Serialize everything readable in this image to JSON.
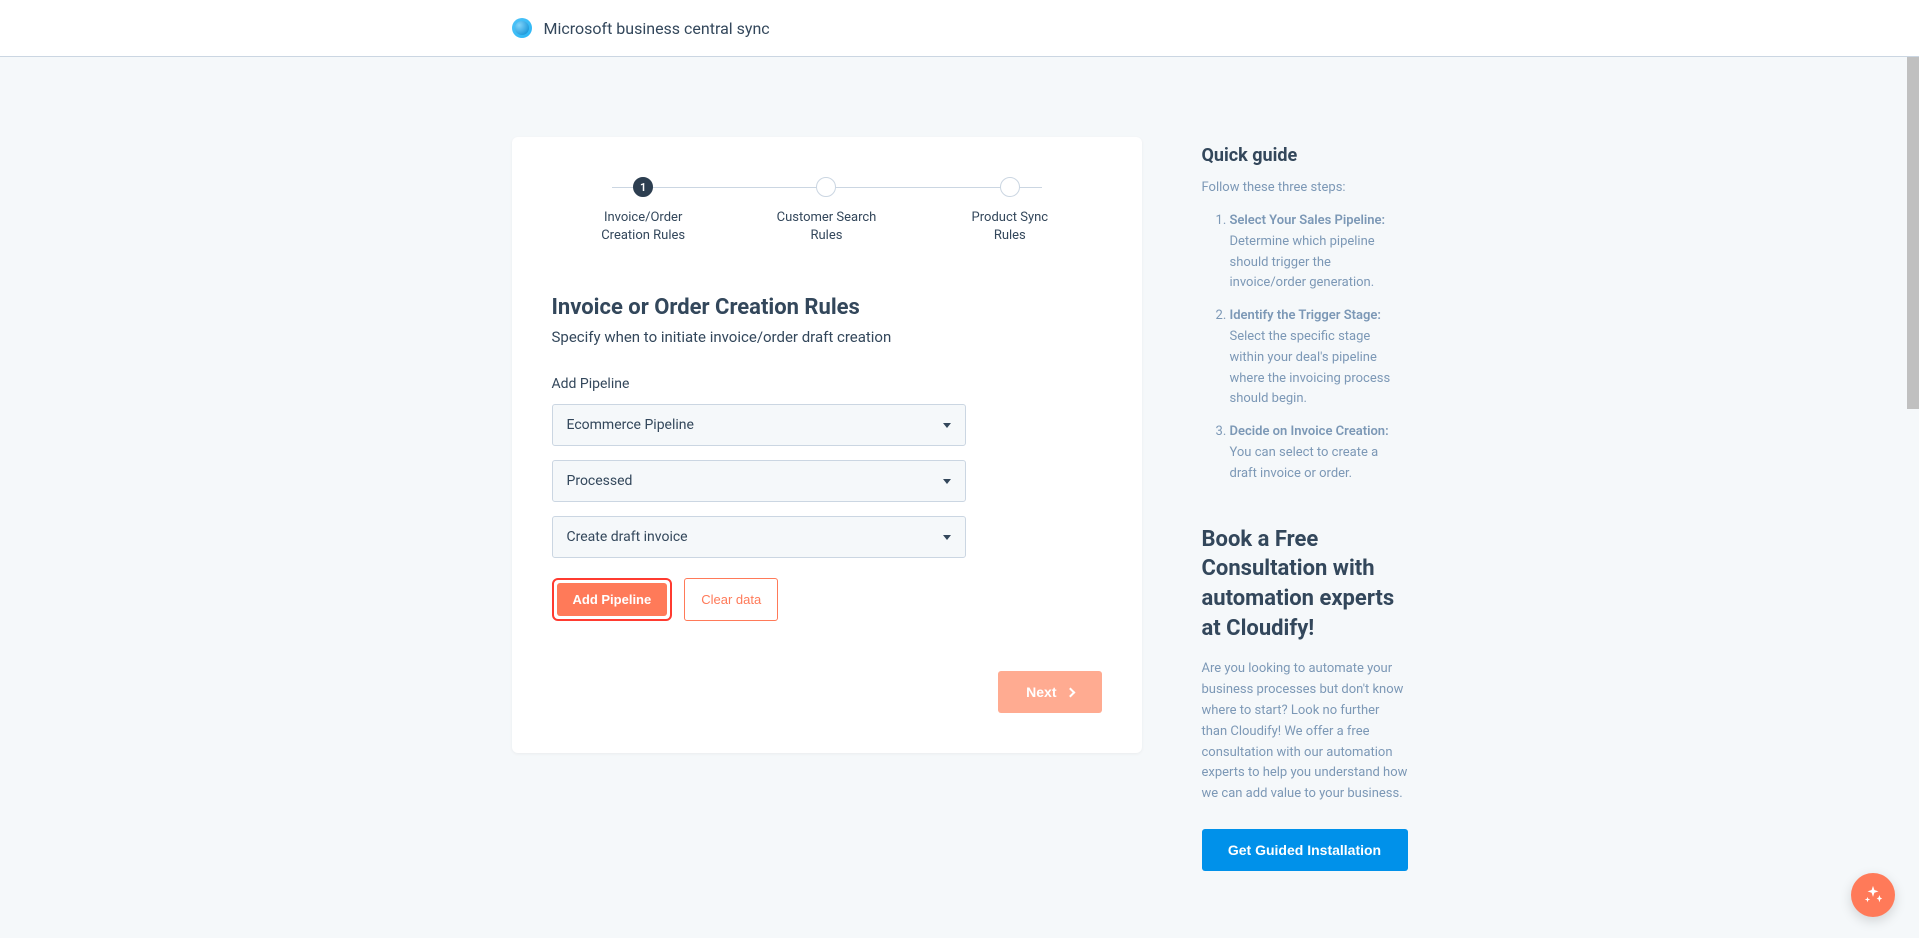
{
  "header": {
    "title": "Microsoft business central sync"
  },
  "stepper": {
    "steps": [
      {
        "num": "1",
        "label": "Invoice/Order Creation Rules",
        "active": true
      },
      {
        "num": "",
        "label": "Customer Search Rules",
        "active": false
      },
      {
        "num": "",
        "label": "Product Sync Rules",
        "active": false
      }
    ]
  },
  "form": {
    "title": "Invoice or Order Creation Rules",
    "subtitle": "Specify when to initiate invoice/order draft creation",
    "pipeline_label": "Add Pipeline",
    "dropdowns": [
      {
        "value": "Ecommerce Pipeline"
      },
      {
        "value": "Processed"
      },
      {
        "value": "Create draft invoice"
      }
    ],
    "add_pipeline_label": "Add Pipeline",
    "clear_data_label": "Clear data",
    "next_label": "Next"
  },
  "guide": {
    "title": "Quick guide",
    "intro": "Follow these three steps:",
    "items": [
      {
        "strong": "Select Your Sales Pipeline:",
        "text": " Determine which pipeline should trigger the invoice/order generation."
      },
      {
        "strong": "Identify the Trigger Stage:",
        "text": " Select the specific stage within your deal's pipeline where the invoicing process should begin."
      },
      {
        "strong": "Decide on Invoice Creation:",
        "text": " You can select to create a draft invoice or order."
      }
    ]
  },
  "consult": {
    "title": "Book a Free Consultation with automation experts at Cloudify!",
    "text": "Are you looking to automate your business processes but don't know where to start? Look no further than Cloudify! We offer a free consultation with our automation experts to help you understand how we can add value to your business.",
    "cta_label": "Get Guided Installation"
  }
}
